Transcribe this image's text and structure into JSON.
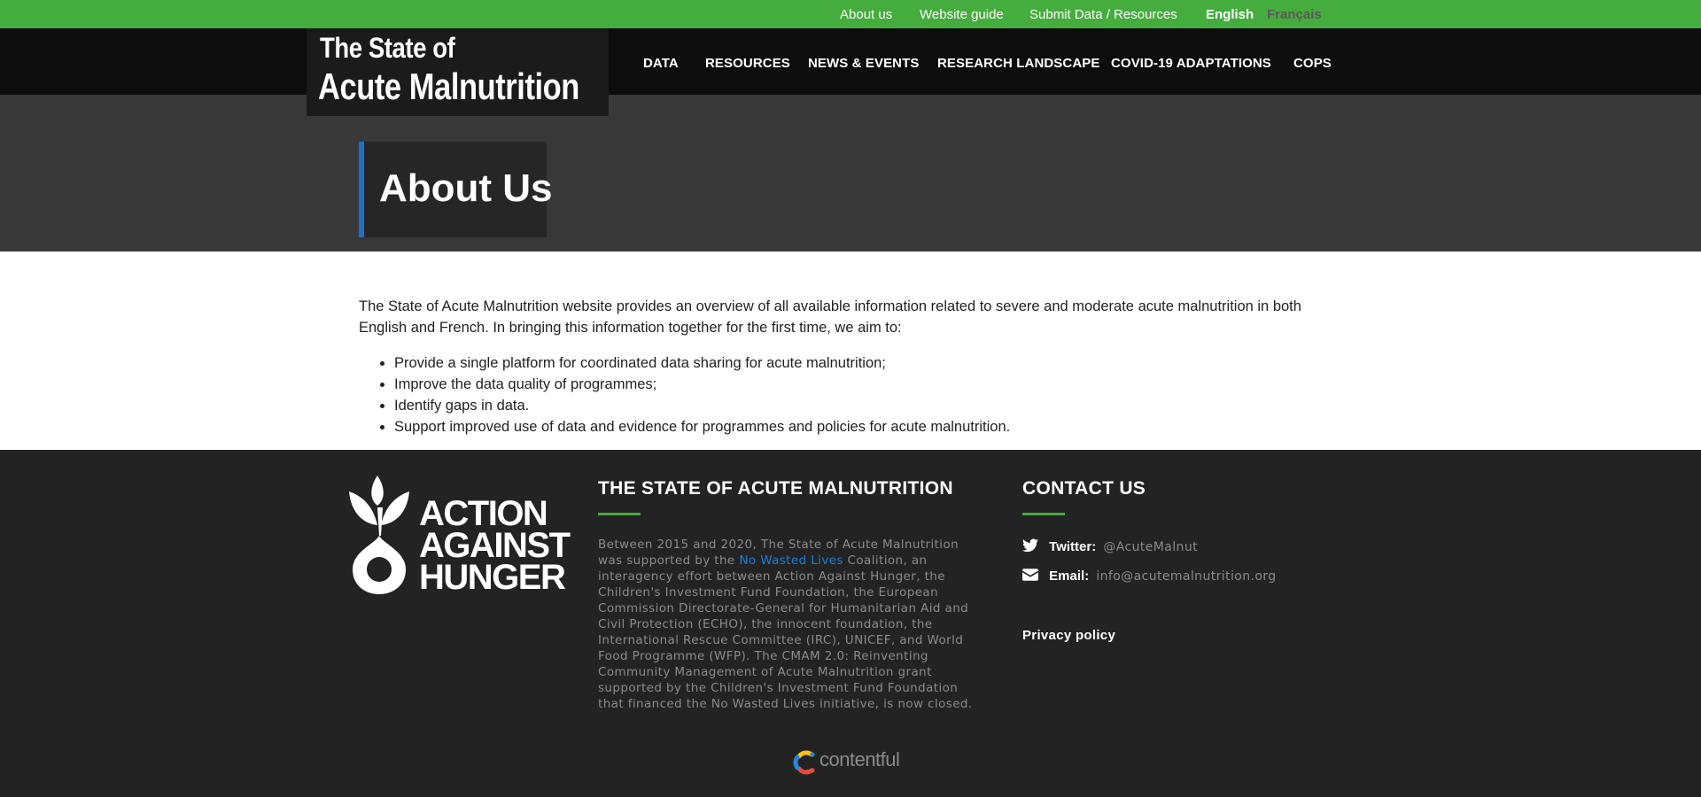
{
  "topbar": {
    "links": [
      "About us",
      "Website guide",
      "Submit Data / Resources"
    ],
    "lang_en": "English",
    "lang_fr": "Français",
    "bg_color": "#45ac3e"
  },
  "logo": {
    "line1": "The State of",
    "line2": "Acute Malnutrition"
  },
  "nav": {
    "items": [
      "DATA",
      "RESOURCES",
      "NEWS & EVENTS",
      "RESEARCH LANDSCAPE",
      "COVID-19 ADAPTATIONS",
      "COPS"
    ]
  },
  "hero": {
    "title": "About Us",
    "accent_color": "#1f6fc4"
  },
  "content": {
    "intro": "The State of Acute Malnutrition website provides an overview of all available information related to severe and moderate acute malnutrition in both English and French. In bringing this information together for the first time, we aim to:",
    "bullets": [
      "Provide a single platform for coordinated data sharing for acute malnutrition;",
      "Improve the data quality of programmes;",
      "Identify gaps in data.",
      "Support improved use of data and evidence for programmes and policies for acute malnutrition."
    ]
  },
  "footer": {
    "logo_lines": [
      "ACTION",
      "AGAINST",
      "HUNGER"
    ],
    "about_heading": "THE STATE OF ACUTE MALNUTRITION",
    "about_text_before": "Between 2015 and 2020, The State of Acute Malnutrition was supported by the ",
    "about_link": "No Wasted Lives",
    "about_text_after": " Coalition, an interagency effort between Action Against Hunger, the Children's Investment Fund Foundation, the European Commission Directorate-General for Humanitarian Aid and Civil Protection (ECHO), the innocent foundation, the International Rescue Committee (IRC), UNICEF, and World Food Programme (WFP). The CMAM 2.0: Reinventing Community Management of Acute Malnutrition grant supported by the Children's Investment Fund Foundation that financed the No Wasted Lives initiative, is now closed.",
    "contact_heading": "CONTACT US",
    "twitter_label": "Twitter:",
    "twitter_value": "@AcuteMalnut",
    "email_label": "Email:",
    "email_value": "info@acutemalnutrition.org",
    "privacy": "Privacy policy",
    "powered_by": "contentful",
    "accent_color": "#45ac3e",
    "icons": [
      "twitter-icon",
      "envelope-icon",
      "action-against-hunger-logo",
      "contentful-logo"
    ]
  }
}
